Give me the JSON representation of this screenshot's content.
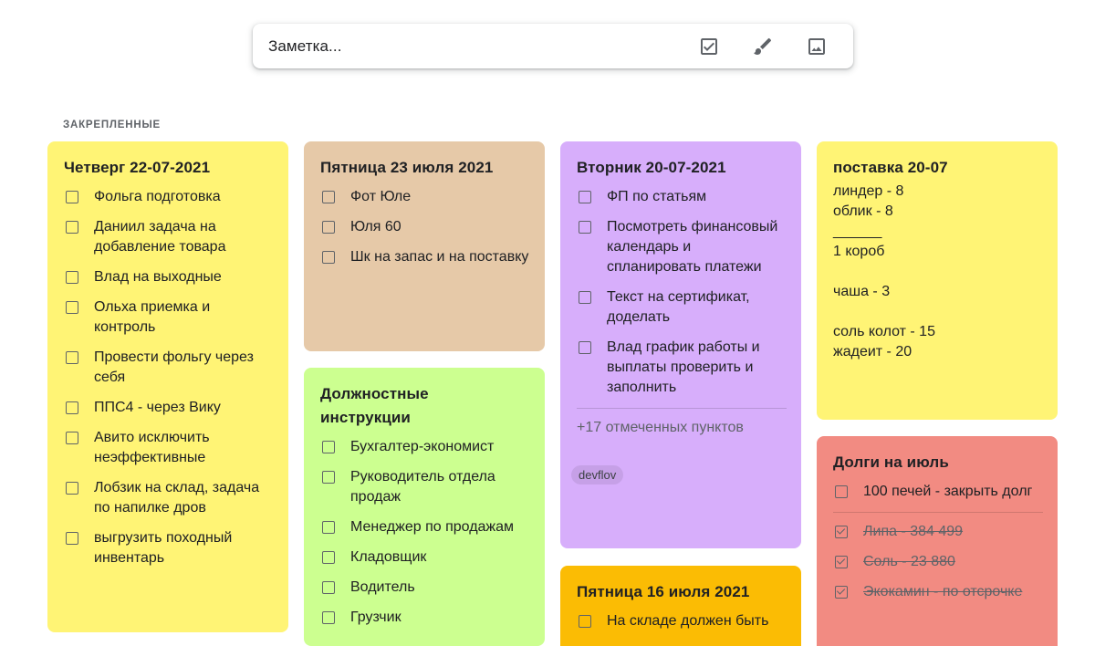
{
  "take_note": {
    "placeholder": "Заметка...",
    "icons": [
      "checkbox-icon",
      "brush-icon",
      "image-icon"
    ]
  },
  "section_label": "ЗАКРЕПЛЕННЫЕ",
  "colors": {
    "yellow": "#fff475",
    "brown": "#e6c9a8",
    "green": "#ccff90",
    "purple": "#d7aefb",
    "orange": "#fbbc04",
    "red": "#f28b82"
  },
  "notes": [
    {
      "title": "Четверг 22-07-2021",
      "items": [
        "Фольга подготовка",
        "Даниил задача на добавление товара",
        "Влад на выходные",
        "Ольха приемка и контроль",
        "Провести фольгу через себя",
        "ППС4 - через Вику",
        "Авито исключить неэффективные",
        "Лобзик на склад, задача по напилке дров",
        "выгрузить походный инвентарь"
      ]
    },
    {
      "title": "Пятница 23 июля 2021",
      "items": [
        "Фот Юле",
        "Юля 60",
        "Шк на запас и на поставку"
      ]
    },
    {
      "title": "Должностные инструкции",
      "items": [
        "Бухгалтер-экономист",
        "Руководитель отдела продаж",
        "Менеджер по продажам",
        "Кладовщик",
        "Водитель",
        "Грузчик"
      ]
    },
    {
      "title": "Вторник 20-07-2021",
      "items": [
        "ФП по статьям",
        "Посмотреть финансовый календарь и спланировать платежи",
        "Текст на сертификат, доделать",
        "Влад график работы и выплаты проверить и заполнить"
      ],
      "checked_summary": "+17 отмеченных пунктов",
      "label": "devflov"
    },
    {
      "title": "Пятница 16 июля 2021",
      "items": [
        "На складе должен быть"
      ]
    },
    {
      "title": "поставка 20-07",
      "lines": [
        "линдер - 8",
        "облик - 8",
        "______",
        "1 короб",
        "",
        "чаша - 3",
        "",
        "соль колот - 15",
        "жадеит - 20"
      ]
    },
    {
      "title": "Долги на июль",
      "items": [
        "100 печей - закрыть долг"
      ],
      "done_items": [
        "Липа - 384 499",
        "Соль - 23 880",
        "Экокамин - по отсрочке"
      ]
    }
  ]
}
